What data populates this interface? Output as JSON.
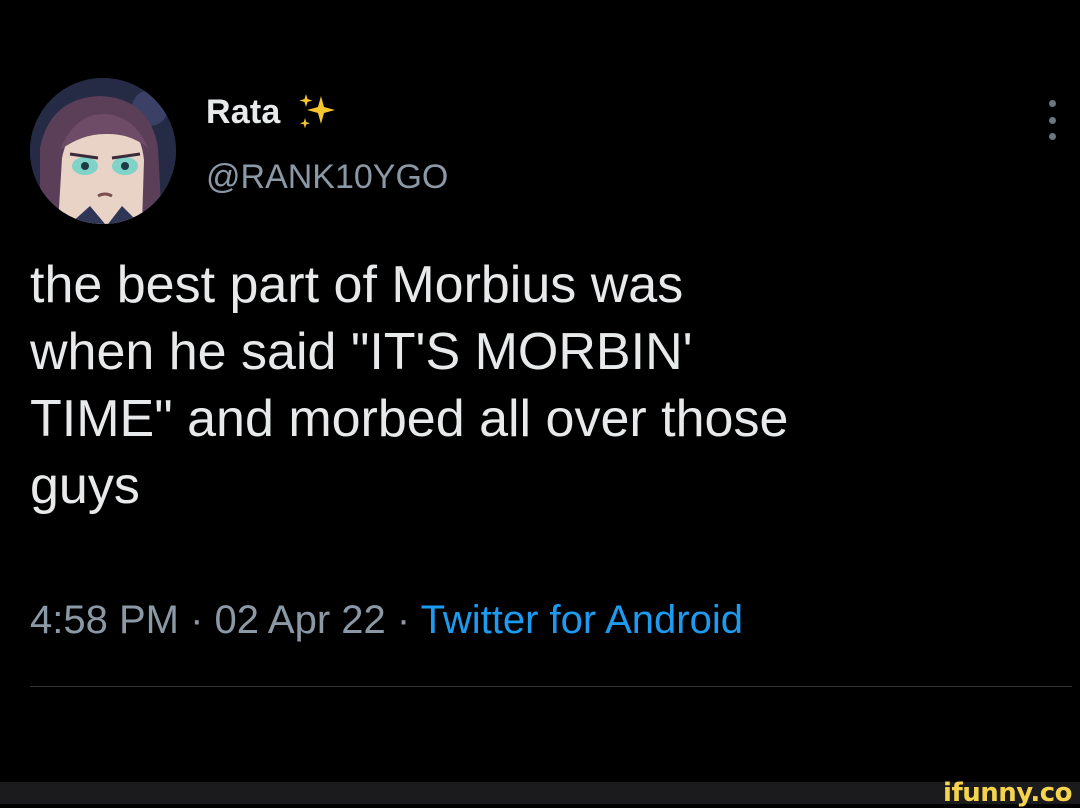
{
  "author": {
    "display_name": "Rata",
    "handle": "@RANK10YGO",
    "avatar_icon": "anime-character-avatar",
    "badge_icon": "sparkles-emoji-icon"
  },
  "tweet": {
    "text": "the best part of Morbius was\nwhen he said \"IT'S MORBIN'\nTIME\" and morbed all over those\nguys",
    "time": "4:58 PM",
    "separator": " · ",
    "date": "02 Apr 22",
    "source": "Twitter for Android"
  },
  "menu": {
    "icon": "more-vertical-icon"
  },
  "watermark": {
    "text": "ifunny.co"
  },
  "colors": {
    "background": "#000000",
    "text_primary": "#e7e9ea",
    "text_secondary": "#8b98a5",
    "link": "#1d9bf0",
    "watermark": "#f5d34d"
  }
}
